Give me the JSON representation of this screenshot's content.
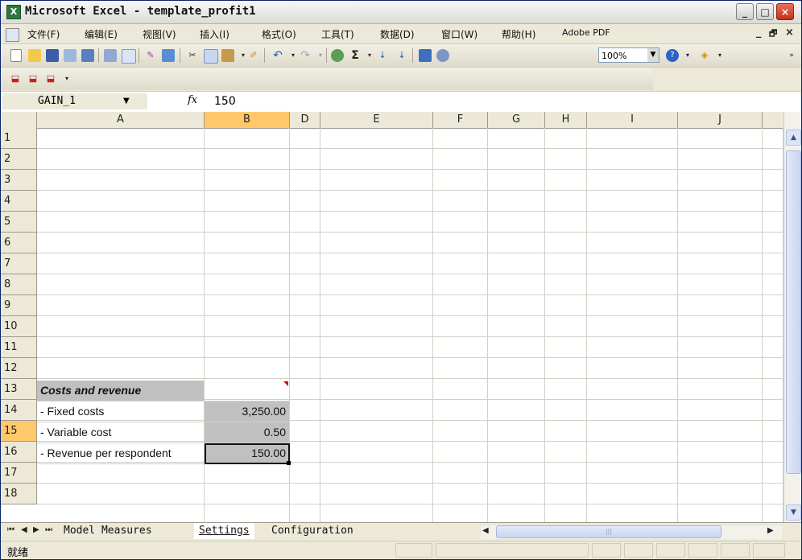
{
  "window": {
    "app_icon": "excel-icon",
    "title": "Microsoft Excel - template_profit1",
    "controls": {
      "minimize": "_",
      "maximize": "□",
      "close": "×"
    }
  },
  "menubar": {
    "items": [
      "文件(F)",
      "编辑(E)",
      "视图(V)",
      "插入(I)",
      "格式(O)",
      "工具(T)",
      "数据(D)",
      "窗口(W)",
      "帮助(H)",
      "Adobe PDF"
    ],
    "doc_controls": {
      "minimize": "_",
      "restore": "🗗",
      "close": "×"
    }
  },
  "toolbar": {
    "zoom": "100%",
    "icons": [
      "new-icon",
      "open-icon",
      "save-icon",
      "permission-icon",
      "print-icon",
      "print-preview-icon",
      "spelling-icon",
      "research-icon",
      "cut-icon",
      "copy-icon",
      "paste-icon",
      "format-painter-icon",
      "undo-icon",
      "redo-icon",
      "hyperlink-icon",
      "autosum-icon",
      "sort-ascending-icon",
      "sort-descending-icon",
      "chart-wizard-icon",
      "drawing-icon",
      "help-icon",
      "fill-color-icon"
    ],
    "pdf_icons": [
      "convert-to-pdf-icon",
      "convert-and-email-icon",
      "convert-and-review-icon"
    ]
  },
  "formula_bar": {
    "name_box": "GAIN_1",
    "fx": "fx",
    "value": "150"
  },
  "sheet": {
    "columns": [
      "A",
      "B",
      "D",
      "E",
      "F",
      "G",
      "H",
      "I",
      "J"
    ],
    "active_column": "B",
    "rows": [
      "1",
      "2",
      "3",
      "4",
      "5",
      "6",
      "7",
      "8",
      "9",
      "10",
      "11",
      "12",
      "13",
      "14",
      "15",
      "16",
      "17",
      "18"
    ],
    "active_row": "15",
    "cells": {
      "a12": "Costs and revenue",
      "a13": "- Fixed costs",
      "b13": "3,250.00",
      "a14": "- Variable cost",
      "b14": "0.50",
      "a15": "- Revenue per respondent",
      "b15": "150.00"
    }
  },
  "tabs": {
    "items": [
      "Model Measures",
      "Settings",
      "Configuration"
    ],
    "active": "Settings"
  },
  "status": {
    "text": "就绪"
  }
}
